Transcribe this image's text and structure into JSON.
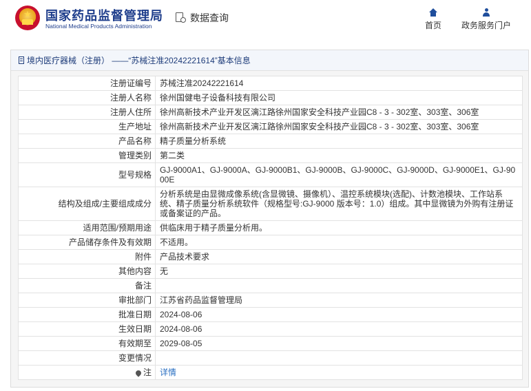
{
  "header": {
    "logo_cn": "国家药品监督管理局",
    "logo_en": "National Medical Products Administration",
    "query_label": "数据查询",
    "nav": [
      {
        "label": "首页",
        "icon": "home-icon"
      },
      {
        "label": "政务服务门户",
        "icon": "user-icon"
      }
    ]
  },
  "panel": {
    "title": "境内医疗器械（注册） ——“苏械注准20242221614”基本信息"
  },
  "rows": [
    {
      "key": "注册证编号",
      "value": "苏械注准20242221614"
    },
    {
      "key": "注册人名称",
      "value": "徐州国健电子设备科技有限公司"
    },
    {
      "key": "注册人住所",
      "value": "徐州高新技术产业开发区漓江路徐州国家安全科技产业园C8 - 3 - 302室、303室、306室"
    },
    {
      "key": "生产地址",
      "value": "徐州高新技术产业开发区漓江路徐州国家安全科技产业园C8 - 3 - 302室、303室、306室"
    },
    {
      "key": "产品名称",
      "value": "精子质量分析系统"
    },
    {
      "key": "管理类别",
      "value": "第二类"
    },
    {
      "key": "型号规格",
      "value": "GJ-9000A1、GJ-9000A、GJ-9000B1、GJ-9000B、GJ-9000C、GJ-9000D、GJ-9000E1、GJ-9000E"
    },
    {
      "key": "结构及组成/主要组成成分",
      "value": "分析系统是由显微成像系统(含显微镜、摄像机）、温控系统模块(选配)、计数池模块、工作站系统、精子质量分析系统软件（规格型号:GJ-9000 版本号：1.0）组成。其中显微镜为外购有注册证或备案证的产品。"
    },
    {
      "key": "适用范围/预期用途",
      "value": "供临床用于精子质量分析用。"
    },
    {
      "key": "产品储存条件及有效期",
      "value": "不适用。"
    },
    {
      "key": "附件",
      "value": "产品技术要求"
    },
    {
      "key": "其他内容",
      "value": "无"
    },
    {
      "key": "备注",
      "value": ""
    },
    {
      "key": "审批部门",
      "value": "江苏省药品监督管理局"
    },
    {
      "key": "批准日期",
      "value": "2024-08-06"
    },
    {
      "key": "生效日期",
      "value": "2024-08-06"
    },
    {
      "key": "有效期至",
      "value": "2029-08-05"
    },
    {
      "key": "变更情况",
      "value": ""
    }
  ],
  "note_row": {
    "key": "注",
    "value": "详情",
    "icon": "pin-icon"
  }
}
